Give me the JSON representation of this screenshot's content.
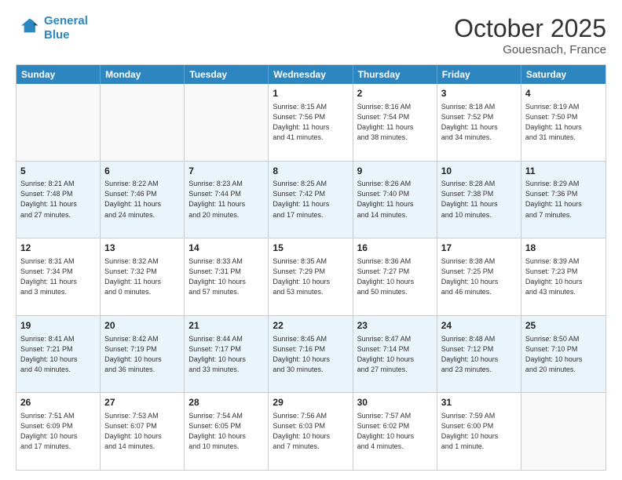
{
  "header": {
    "logo_line1": "General",
    "logo_line2": "Blue",
    "main_title": "October 2025",
    "subtitle": "Gouesnach, France"
  },
  "calendar": {
    "days": [
      "Sunday",
      "Monday",
      "Tuesday",
      "Wednesday",
      "Thursday",
      "Friday",
      "Saturday"
    ],
    "rows": [
      [
        {
          "day": "",
          "info": ""
        },
        {
          "day": "",
          "info": ""
        },
        {
          "day": "",
          "info": ""
        },
        {
          "day": "1",
          "info": "Sunrise: 8:15 AM\nSunset: 7:56 PM\nDaylight: 11 hours\nand 41 minutes."
        },
        {
          "day": "2",
          "info": "Sunrise: 8:16 AM\nSunset: 7:54 PM\nDaylight: 11 hours\nand 38 minutes."
        },
        {
          "day": "3",
          "info": "Sunrise: 8:18 AM\nSunset: 7:52 PM\nDaylight: 11 hours\nand 34 minutes."
        },
        {
          "day": "4",
          "info": "Sunrise: 8:19 AM\nSunset: 7:50 PM\nDaylight: 11 hours\nand 31 minutes."
        }
      ],
      [
        {
          "day": "5",
          "info": "Sunrise: 8:21 AM\nSunset: 7:48 PM\nDaylight: 11 hours\nand 27 minutes."
        },
        {
          "day": "6",
          "info": "Sunrise: 8:22 AM\nSunset: 7:46 PM\nDaylight: 11 hours\nand 24 minutes."
        },
        {
          "day": "7",
          "info": "Sunrise: 8:23 AM\nSunset: 7:44 PM\nDaylight: 11 hours\nand 20 minutes."
        },
        {
          "day": "8",
          "info": "Sunrise: 8:25 AM\nSunset: 7:42 PM\nDaylight: 11 hours\nand 17 minutes."
        },
        {
          "day": "9",
          "info": "Sunrise: 8:26 AM\nSunset: 7:40 PM\nDaylight: 11 hours\nand 14 minutes."
        },
        {
          "day": "10",
          "info": "Sunrise: 8:28 AM\nSunset: 7:38 PM\nDaylight: 11 hours\nand 10 minutes."
        },
        {
          "day": "11",
          "info": "Sunrise: 8:29 AM\nSunset: 7:36 PM\nDaylight: 11 hours\nand 7 minutes."
        }
      ],
      [
        {
          "day": "12",
          "info": "Sunrise: 8:31 AM\nSunset: 7:34 PM\nDaylight: 11 hours\nand 3 minutes."
        },
        {
          "day": "13",
          "info": "Sunrise: 8:32 AM\nSunset: 7:32 PM\nDaylight: 11 hours\nand 0 minutes."
        },
        {
          "day": "14",
          "info": "Sunrise: 8:33 AM\nSunset: 7:31 PM\nDaylight: 10 hours\nand 57 minutes."
        },
        {
          "day": "15",
          "info": "Sunrise: 8:35 AM\nSunset: 7:29 PM\nDaylight: 10 hours\nand 53 minutes."
        },
        {
          "day": "16",
          "info": "Sunrise: 8:36 AM\nSunset: 7:27 PM\nDaylight: 10 hours\nand 50 minutes."
        },
        {
          "day": "17",
          "info": "Sunrise: 8:38 AM\nSunset: 7:25 PM\nDaylight: 10 hours\nand 46 minutes."
        },
        {
          "day": "18",
          "info": "Sunrise: 8:39 AM\nSunset: 7:23 PM\nDaylight: 10 hours\nand 43 minutes."
        }
      ],
      [
        {
          "day": "19",
          "info": "Sunrise: 8:41 AM\nSunset: 7:21 PM\nDaylight: 10 hours\nand 40 minutes."
        },
        {
          "day": "20",
          "info": "Sunrise: 8:42 AM\nSunset: 7:19 PM\nDaylight: 10 hours\nand 36 minutes."
        },
        {
          "day": "21",
          "info": "Sunrise: 8:44 AM\nSunset: 7:17 PM\nDaylight: 10 hours\nand 33 minutes."
        },
        {
          "day": "22",
          "info": "Sunrise: 8:45 AM\nSunset: 7:16 PM\nDaylight: 10 hours\nand 30 minutes."
        },
        {
          "day": "23",
          "info": "Sunrise: 8:47 AM\nSunset: 7:14 PM\nDaylight: 10 hours\nand 27 minutes."
        },
        {
          "day": "24",
          "info": "Sunrise: 8:48 AM\nSunset: 7:12 PM\nDaylight: 10 hours\nand 23 minutes."
        },
        {
          "day": "25",
          "info": "Sunrise: 8:50 AM\nSunset: 7:10 PM\nDaylight: 10 hours\nand 20 minutes."
        }
      ],
      [
        {
          "day": "26",
          "info": "Sunrise: 7:51 AM\nSunset: 6:09 PM\nDaylight: 10 hours\nand 17 minutes."
        },
        {
          "day": "27",
          "info": "Sunrise: 7:53 AM\nSunset: 6:07 PM\nDaylight: 10 hours\nand 14 minutes."
        },
        {
          "day": "28",
          "info": "Sunrise: 7:54 AM\nSunset: 6:05 PM\nDaylight: 10 hours\nand 10 minutes."
        },
        {
          "day": "29",
          "info": "Sunrise: 7:56 AM\nSunset: 6:03 PM\nDaylight: 10 hours\nand 7 minutes."
        },
        {
          "day": "30",
          "info": "Sunrise: 7:57 AM\nSunset: 6:02 PM\nDaylight: 10 hours\nand 4 minutes."
        },
        {
          "day": "31",
          "info": "Sunrise: 7:59 AM\nSunset: 6:00 PM\nDaylight: 10 hours\nand 1 minute."
        },
        {
          "day": "",
          "info": ""
        }
      ]
    ]
  }
}
